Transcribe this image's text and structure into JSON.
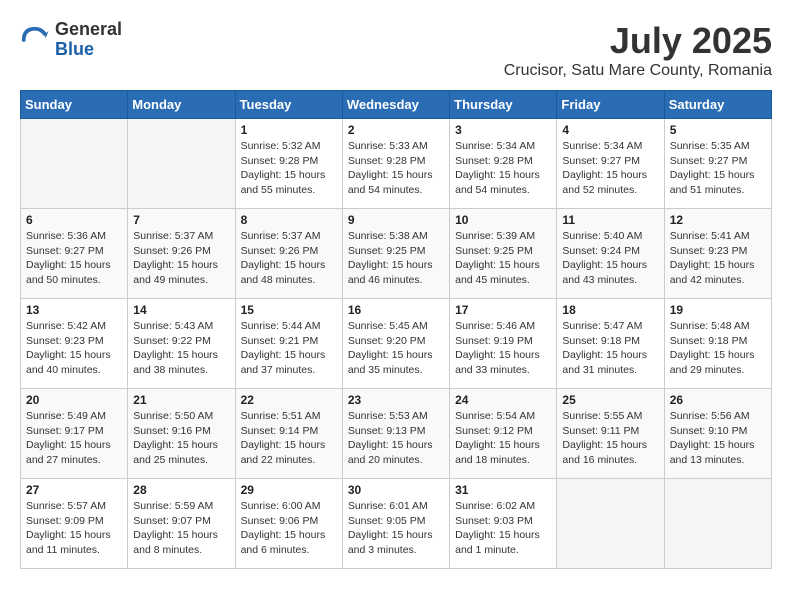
{
  "header": {
    "logo": {
      "general": "General",
      "blue": "Blue"
    },
    "month_year": "July 2025",
    "location": "Crucisor, Satu Mare County, Romania"
  },
  "weekdays": [
    "Sunday",
    "Monday",
    "Tuesday",
    "Wednesday",
    "Thursday",
    "Friday",
    "Saturday"
  ],
  "weeks": [
    [
      {
        "day": "",
        "info": ""
      },
      {
        "day": "",
        "info": ""
      },
      {
        "day": "1",
        "sunrise": "5:32 AM",
        "sunset": "9:28 PM",
        "daylight": "15 hours and 55 minutes."
      },
      {
        "day": "2",
        "sunrise": "5:33 AM",
        "sunset": "9:28 PM",
        "daylight": "15 hours and 54 minutes."
      },
      {
        "day": "3",
        "sunrise": "5:34 AM",
        "sunset": "9:28 PM",
        "daylight": "15 hours and 54 minutes."
      },
      {
        "day": "4",
        "sunrise": "5:34 AM",
        "sunset": "9:27 PM",
        "daylight": "15 hours and 52 minutes."
      },
      {
        "day": "5",
        "sunrise": "5:35 AM",
        "sunset": "9:27 PM",
        "daylight": "15 hours and 51 minutes."
      }
    ],
    [
      {
        "day": "6",
        "sunrise": "5:36 AM",
        "sunset": "9:27 PM",
        "daylight": "15 hours and 50 minutes."
      },
      {
        "day": "7",
        "sunrise": "5:37 AM",
        "sunset": "9:26 PM",
        "daylight": "15 hours and 49 minutes."
      },
      {
        "day": "8",
        "sunrise": "5:37 AM",
        "sunset": "9:26 PM",
        "daylight": "15 hours and 48 minutes."
      },
      {
        "day": "9",
        "sunrise": "5:38 AM",
        "sunset": "9:25 PM",
        "daylight": "15 hours and 46 minutes."
      },
      {
        "day": "10",
        "sunrise": "5:39 AM",
        "sunset": "9:25 PM",
        "daylight": "15 hours and 45 minutes."
      },
      {
        "day": "11",
        "sunrise": "5:40 AM",
        "sunset": "9:24 PM",
        "daylight": "15 hours and 43 minutes."
      },
      {
        "day": "12",
        "sunrise": "5:41 AM",
        "sunset": "9:23 PM",
        "daylight": "15 hours and 42 minutes."
      }
    ],
    [
      {
        "day": "13",
        "sunrise": "5:42 AM",
        "sunset": "9:23 PM",
        "daylight": "15 hours and 40 minutes."
      },
      {
        "day": "14",
        "sunrise": "5:43 AM",
        "sunset": "9:22 PM",
        "daylight": "15 hours and 38 minutes."
      },
      {
        "day": "15",
        "sunrise": "5:44 AM",
        "sunset": "9:21 PM",
        "daylight": "15 hours and 37 minutes."
      },
      {
        "day": "16",
        "sunrise": "5:45 AM",
        "sunset": "9:20 PM",
        "daylight": "15 hours and 35 minutes."
      },
      {
        "day": "17",
        "sunrise": "5:46 AM",
        "sunset": "9:19 PM",
        "daylight": "15 hours and 33 minutes."
      },
      {
        "day": "18",
        "sunrise": "5:47 AM",
        "sunset": "9:18 PM",
        "daylight": "15 hours and 31 minutes."
      },
      {
        "day": "19",
        "sunrise": "5:48 AM",
        "sunset": "9:18 PM",
        "daylight": "15 hours and 29 minutes."
      }
    ],
    [
      {
        "day": "20",
        "sunrise": "5:49 AM",
        "sunset": "9:17 PM",
        "daylight": "15 hours and 27 minutes."
      },
      {
        "day": "21",
        "sunrise": "5:50 AM",
        "sunset": "9:16 PM",
        "daylight": "15 hours and 25 minutes."
      },
      {
        "day": "22",
        "sunrise": "5:51 AM",
        "sunset": "9:14 PM",
        "daylight": "15 hours and 22 minutes."
      },
      {
        "day": "23",
        "sunrise": "5:53 AM",
        "sunset": "9:13 PM",
        "daylight": "15 hours and 20 minutes."
      },
      {
        "day": "24",
        "sunrise": "5:54 AM",
        "sunset": "9:12 PM",
        "daylight": "15 hours and 18 minutes."
      },
      {
        "day": "25",
        "sunrise": "5:55 AM",
        "sunset": "9:11 PM",
        "daylight": "15 hours and 16 minutes."
      },
      {
        "day": "26",
        "sunrise": "5:56 AM",
        "sunset": "9:10 PM",
        "daylight": "15 hours and 13 minutes."
      }
    ],
    [
      {
        "day": "27",
        "sunrise": "5:57 AM",
        "sunset": "9:09 PM",
        "daylight": "15 hours and 11 minutes."
      },
      {
        "day": "28",
        "sunrise": "5:59 AM",
        "sunset": "9:07 PM",
        "daylight": "15 hours and 8 minutes."
      },
      {
        "day": "29",
        "sunrise": "6:00 AM",
        "sunset": "9:06 PM",
        "daylight": "15 hours and 6 minutes."
      },
      {
        "day": "30",
        "sunrise": "6:01 AM",
        "sunset": "9:05 PM",
        "daylight": "15 hours and 3 minutes."
      },
      {
        "day": "31",
        "sunrise": "6:02 AM",
        "sunset": "9:03 PM",
        "daylight": "15 hours and 1 minute."
      },
      {
        "day": "",
        "info": ""
      },
      {
        "day": "",
        "info": ""
      }
    ]
  ]
}
